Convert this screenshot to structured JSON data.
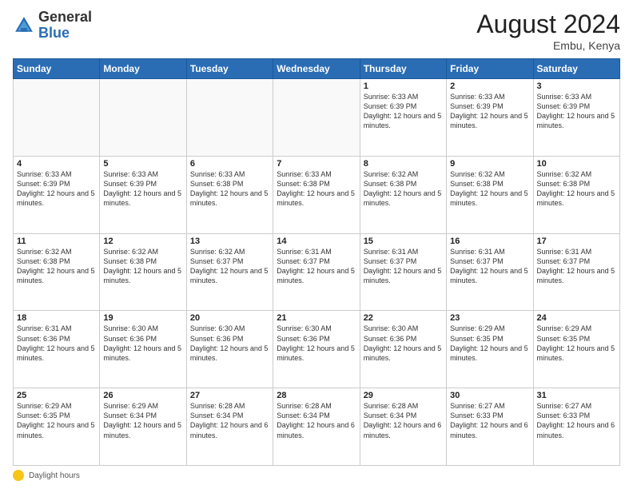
{
  "header": {
    "logo_general": "General",
    "logo_blue": "Blue",
    "month_year": "August 2024",
    "location": "Embu, Kenya"
  },
  "footer": {
    "daylight_label": "Daylight hours"
  },
  "weekdays": [
    "Sunday",
    "Monday",
    "Tuesday",
    "Wednesday",
    "Thursday",
    "Friday",
    "Saturday"
  ],
  "weeks": [
    [
      {
        "day": "",
        "sunrise": "",
        "sunset": "",
        "daylight": "",
        "empty": true
      },
      {
        "day": "",
        "sunrise": "",
        "sunset": "",
        "daylight": "",
        "empty": true
      },
      {
        "day": "",
        "sunrise": "",
        "sunset": "",
        "daylight": "",
        "empty": true
      },
      {
        "day": "",
        "sunrise": "",
        "sunset": "",
        "daylight": "",
        "empty": true
      },
      {
        "day": "1",
        "sunrise": "Sunrise: 6:33 AM",
        "sunset": "Sunset: 6:39 PM",
        "daylight": "Daylight: 12 hours and 5 minutes.",
        "empty": false
      },
      {
        "day": "2",
        "sunrise": "Sunrise: 6:33 AM",
        "sunset": "Sunset: 6:39 PM",
        "daylight": "Daylight: 12 hours and 5 minutes.",
        "empty": false
      },
      {
        "day": "3",
        "sunrise": "Sunrise: 6:33 AM",
        "sunset": "Sunset: 6:39 PM",
        "daylight": "Daylight: 12 hours and 5 minutes.",
        "empty": false
      }
    ],
    [
      {
        "day": "4",
        "sunrise": "Sunrise: 6:33 AM",
        "sunset": "Sunset: 6:39 PM",
        "daylight": "Daylight: 12 hours and 5 minutes.",
        "empty": false
      },
      {
        "day": "5",
        "sunrise": "Sunrise: 6:33 AM",
        "sunset": "Sunset: 6:39 PM",
        "daylight": "Daylight: 12 hours and 5 minutes.",
        "empty": false
      },
      {
        "day": "6",
        "sunrise": "Sunrise: 6:33 AM",
        "sunset": "Sunset: 6:38 PM",
        "daylight": "Daylight: 12 hours and 5 minutes.",
        "empty": false
      },
      {
        "day": "7",
        "sunrise": "Sunrise: 6:33 AM",
        "sunset": "Sunset: 6:38 PM",
        "daylight": "Daylight: 12 hours and 5 minutes.",
        "empty": false
      },
      {
        "day": "8",
        "sunrise": "Sunrise: 6:32 AM",
        "sunset": "Sunset: 6:38 PM",
        "daylight": "Daylight: 12 hours and 5 minutes.",
        "empty": false
      },
      {
        "day": "9",
        "sunrise": "Sunrise: 6:32 AM",
        "sunset": "Sunset: 6:38 PM",
        "daylight": "Daylight: 12 hours and 5 minutes.",
        "empty": false
      },
      {
        "day": "10",
        "sunrise": "Sunrise: 6:32 AM",
        "sunset": "Sunset: 6:38 PM",
        "daylight": "Daylight: 12 hours and 5 minutes.",
        "empty": false
      }
    ],
    [
      {
        "day": "11",
        "sunrise": "Sunrise: 6:32 AM",
        "sunset": "Sunset: 6:38 PM",
        "daylight": "Daylight: 12 hours and 5 minutes.",
        "empty": false
      },
      {
        "day": "12",
        "sunrise": "Sunrise: 6:32 AM",
        "sunset": "Sunset: 6:38 PM",
        "daylight": "Daylight: 12 hours and 5 minutes.",
        "empty": false
      },
      {
        "day": "13",
        "sunrise": "Sunrise: 6:32 AM",
        "sunset": "Sunset: 6:37 PM",
        "daylight": "Daylight: 12 hours and 5 minutes.",
        "empty": false
      },
      {
        "day": "14",
        "sunrise": "Sunrise: 6:31 AM",
        "sunset": "Sunset: 6:37 PM",
        "daylight": "Daylight: 12 hours and 5 minutes.",
        "empty": false
      },
      {
        "day": "15",
        "sunrise": "Sunrise: 6:31 AM",
        "sunset": "Sunset: 6:37 PM",
        "daylight": "Daylight: 12 hours and 5 minutes.",
        "empty": false
      },
      {
        "day": "16",
        "sunrise": "Sunrise: 6:31 AM",
        "sunset": "Sunset: 6:37 PM",
        "daylight": "Daylight: 12 hours and 5 minutes.",
        "empty": false
      },
      {
        "day": "17",
        "sunrise": "Sunrise: 6:31 AM",
        "sunset": "Sunset: 6:37 PM",
        "daylight": "Daylight: 12 hours and 5 minutes.",
        "empty": false
      }
    ],
    [
      {
        "day": "18",
        "sunrise": "Sunrise: 6:31 AM",
        "sunset": "Sunset: 6:36 PM",
        "daylight": "Daylight: 12 hours and 5 minutes.",
        "empty": false
      },
      {
        "day": "19",
        "sunrise": "Sunrise: 6:30 AM",
        "sunset": "Sunset: 6:36 PM",
        "daylight": "Daylight: 12 hours and 5 minutes.",
        "empty": false
      },
      {
        "day": "20",
        "sunrise": "Sunrise: 6:30 AM",
        "sunset": "Sunset: 6:36 PM",
        "daylight": "Daylight: 12 hours and 5 minutes.",
        "empty": false
      },
      {
        "day": "21",
        "sunrise": "Sunrise: 6:30 AM",
        "sunset": "Sunset: 6:36 PM",
        "daylight": "Daylight: 12 hours and 5 minutes.",
        "empty": false
      },
      {
        "day": "22",
        "sunrise": "Sunrise: 6:30 AM",
        "sunset": "Sunset: 6:36 PM",
        "daylight": "Daylight: 12 hours and 5 minutes.",
        "empty": false
      },
      {
        "day": "23",
        "sunrise": "Sunrise: 6:29 AM",
        "sunset": "Sunset: 6:35 PM",
        "daylight": "Daylight: 12 hours and 5 minutes.",
        "empty": false
      },
      {
        "day": "24",
        "sunrise": "Sunrise: 6:29 AM",
        "sunset": "Sunset: 6:35 PM",
        "daylight": "Daylight: 12 hours and 5 minutes.",
        "empty": false
      }
    ],
    [
      {
        "day": "25",
        "sunrise": "Sunrise: 6:29 AM",
        "sunset": "Sunset: 6:35 PM",
        "daylight": "Daylight: 12 hours and 5 minutes.",
        "empty": false
      },
      {
        "day": "26",
        "sunrise": "Sunrise: 6:29 AM",
        "sunset": "Sunset: 6:34 PM",
        "daylight": "Daylight: 12 hours and 5 minutes.",
        "empty": false
      },
      {
        "day": "27",
        "sunrise": "Sunrise: 6:28 AM",
        "sunset": "Sunset: 6:34 PM",
        "daylight": "Daylight: 12 hours and 6 minutes.",
        "empty": false
      },
      {
        "day": "28",
        "sunrise": "Sunrise: 6:28 AM",
        "sunset": "Sunset: 6:34 PM",
        "daylight": "Daylight: 12 hours and 6 minutes.",
        "empty": false
      },
      {
        "day": "29",
        "sunrise": "Sunrise: 6:28 AM",
        "sunset": "Sunset: 6:34 PM",
        "daylight": "Daylight: 12 hours and 6 minutes.",
        "empty": false
      },
      {
        "day": "30",
        "sunrise": "Sunrise: 6:27 AM",
        "sunset": "Sunset: 6:33 PM",
        "daylight": "Daylight: 12 hours and 6 minutes.",
        "empty": false
      },
      {
        "day": "31",
        "sunrise": "Sunrise: 6:27 AM",
        "sunset": "Sunset: 6:33 PM",
        "daylight": "Daylight: 12 hours and 6 minutes.",
        "empty": false
      }
    ]
  ]
}
